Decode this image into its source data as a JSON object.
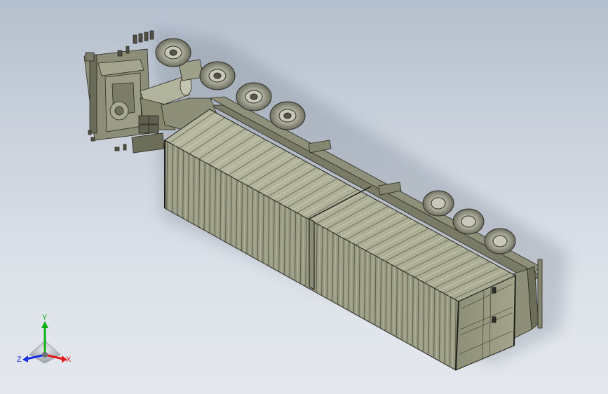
{
  "view": {
    "background_top": "#b4bfcd",
    "background_bottom": "#e4e8ee",
    "model_color": "#9a9b83"
  },
  "triad": {
    "x_label": "X",
    "y_label": "Y",
    "z_label": "Z",
    "x_color": "#e01818",
    "y_color": "#12b012",
    "z_color": "#1a2fe0"
  }
}
